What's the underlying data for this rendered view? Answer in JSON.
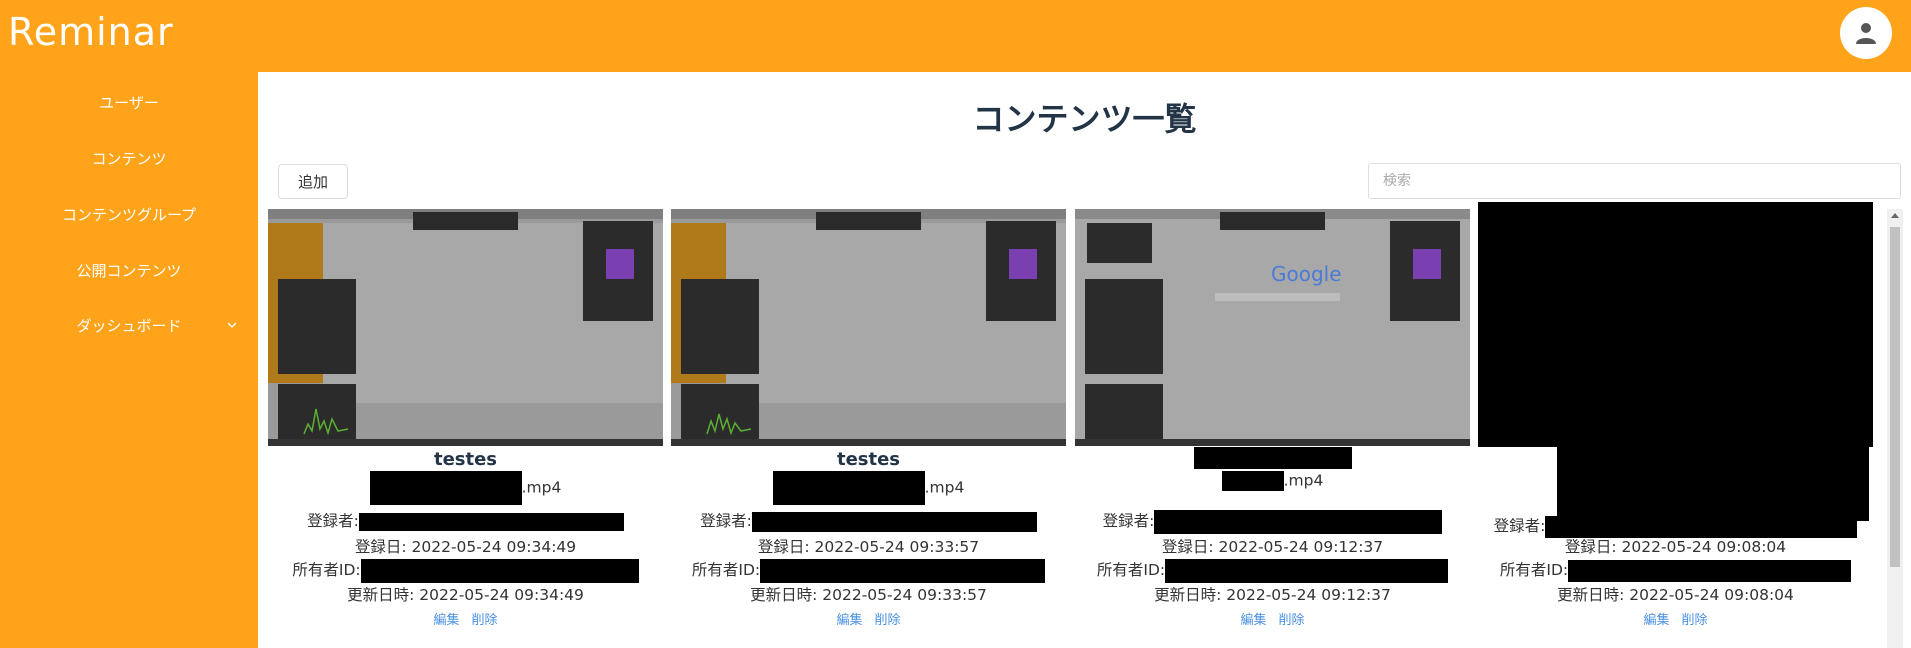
{
  "app": {
    "logo": "Reminar"
  },
  "sidebar": {
    "items": [
      {
        "label": "ユーザー"
      },
      {
        "label": "コンテンツ"
      },
      {
        "label": "コンテンツグループ"
      },
      {
        "label": "公開コンテンツ"
      },
      {
        "label": "ダッシュボード"
      }
    ]
  },
  "main": {
    "title": "コンテンツ一覧",
    "add_label": "追加",
    "search_placeholder": "検索"
  },
  "cards": [
    {
      "title": "testes",
      "file_ext": ".mp4",
      "registrant_label": "登録者:",
      "registered_label": "登録日: ",
      "registered": "2022-05-24 09:34:49",
      "owner_label": "所有者ID:",
      "updated_label": "更新日時: ",
      "updated": "2022-05-24 09:34:49",
      "edit": "編集",
      "delete": "削除"
    },
    {
      "title": "testes",
      "file_ext": ".mp4",
      "registrant_label": "登録者:",
      "registered_label": "登録日: ",
      "registered": "2022-05-24 09:33:57",
      "owner_label": "所有者ID:",
      "updated_label": "更新日時: ",
      "updated": "2022-05-24 09:33:57",
      "edit": "編集",
      "delete": "削除"
    },
    {
      "title": "",
      "file_ext": ".mp4",
      "registrant_label": "登録者:",
      "registered_label": "登録日: ",
      "registered": "2022-05-24 09:12:37",
      "owner_label": "所有者ID:",
      "updated_label": "更新日時: ",
      "updated": "2022-05-24 09:12:37",
      "edit": "編集",
      "delete": "削除"
    },
    {
      "title": "",
      "file_ext": "",
      "registrant_label": "登録者:",
      "registered_label": "登録日: ",
      "registered": "2022-05-24 09:08:04",
      "owner_label": "所有者ID:",
      "updated_label": "更新日時: ",
      "updated": "2022-05-24 09:08:04",
      "edit": "編集",
      "delete": "削除"
    }
  ],
  "colors": {
    "accent": "#ffa31a",
    "title": "#243447",
    "link": "#4a90e2"
  },
  "icons": {
    "avatar": "user-icon",
    "chevron": "chevron-down-icon"
  }
}
